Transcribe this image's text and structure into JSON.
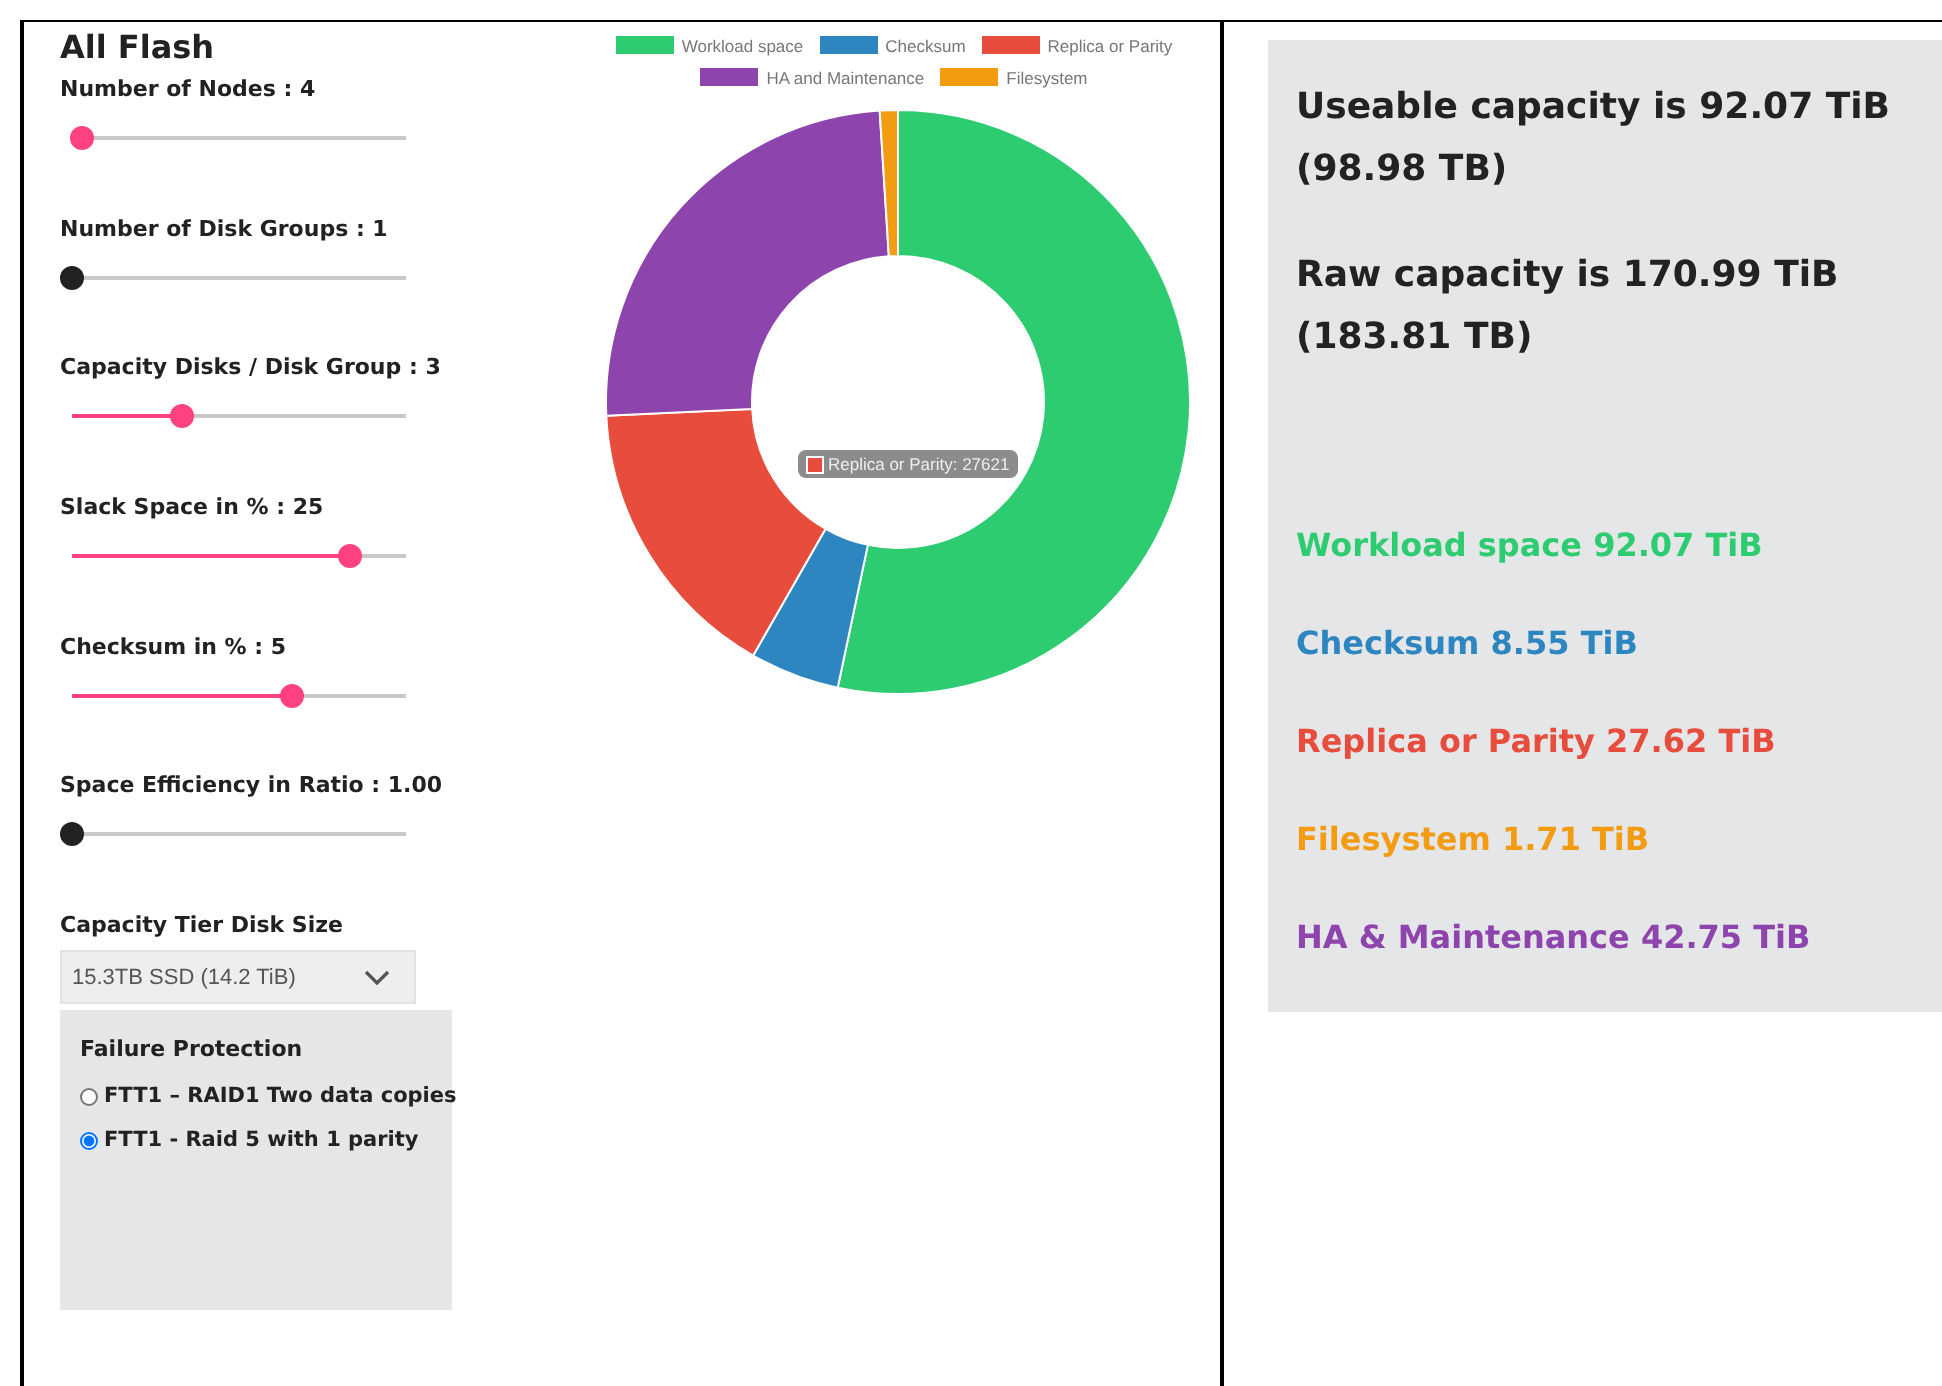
{
  "title": "All Flash",
  "sliders": [
    {
      "label": "Number of Nodes : 4",
      "level": 0.03
    },
    {
      "label": "Number of Disk Groups : 1",
      "level": 0
    },
    {
      "label": "Capacity Disks / Disk Group : 3",
      "level": 0.33
    },
    {
      "label": "Slack Space in % : 25",
      "level": 0.83
    },
    {
      "label": "Checksum in % : 5",
      "level": 0.66
    },
    {
      "label": "Space Efficiency in Ratio : 1.00",
      "level": 0
    }
  ],
  "disk_size": {
    "label": "Capacity Tier Disk Size",
    "value": "15.3TB SSD (14.2 TiB)"
  },
  "failure_protection": {
    "title": "Failure Protection",
    "options": [
      {
        "label": "FTT1 – RAID1 Two data copies",
        "selected": false
      },
      {
        "label": "FTT1 - Raid 5 with 1 parity",
        "selected": true
      }
    ]
  },
  "chart": {
    "tooltip": {
      "text": "Replica or Parity: 27621",
      "color": "#e74c3c"
    },
    "chart_data": {
      "type": "donut",
      "legend": "top",
      "categories": [
        "Workload space",
        "Checksum",
        "Replica or Parity",
        "HA and Maintenance",
        "Filesystem"
      ],
      "colors": [
        "#2ecc71",
        "#2e86c1",
        "#e74c3c",
        "#8e44ad",
        "#f39c12"
      ],
      "series": [
        {
          "values": [
            53.31,
            4.95,
            15.99,
            24.75,
            1.0
          ]
        }
      ]
    }
  },
  "summary": {
    "headlines": [
      "Useable capacity is 92.07 TiB (98.98 TB)",
      "Raw capacity is 170.99 TiB (183.81 TB)"
    ],
    "items": [
      {
        "text": "Workload space 92.07 TiB",
        "color": "#2ecc71"
      },
      {
        "text": "Checksum 8.55 TiB",
        "color": "#2e86c1"
      },
      {
        "text": "Replica or Parity 27.62 TiB",
        "color": "#e74c3c"
      },
      {
        "text": "Filesystem 1.71 TiB",
        "color": "#f39c12"
      },
      {
        "text": "HA & Maintenance 42.75 TiB",
        "color": "#8e44ad"
      }
    ]
  }
}
